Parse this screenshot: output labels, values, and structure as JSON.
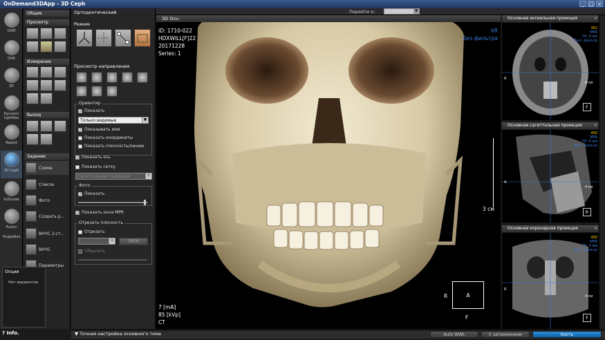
{
  "app": {
    "title": "OnDemand3DApp - 3D Ceph"
  },
  "nav": {
    "items": [
      {
        "label": "DXM"
      },
      {
        "label": "DVR"
      },
      {
        "label": "3D"
      },
      {
        "label": "Dynamic LightBox"
      },
      {
        "label": "Report"
      },
      {
        "label": "3D Ceph"
      },
      {
        "label": "In2Guide"
      },
      {
        "label": "Fusion"
      }
    ],
    "more_label": "Подробно",
    "info_label": "Info."
  },
  "panel2": {
    "header": "Общие",
    "view_section": "Просмотр",
    "measure_section": "Измерение",
    "output_section": "Выход",
    "task_section": "Задание",
    "tasks": [
      {
        "label": "Схема"
      },
      {
        "label": "Список"
      },
      {
        "label": "Фото"
      },
      {
        "label": "Создать р..."
      },
      {
        "label": "ВНЧС 2-ст..."
      },
      {
        "label": "ВНЧС"
      },
      {
        "label": "Параметры"
      }
    ],
    "options_title": "Опции",
    "options_empty": "Нет вариантов"
  },
  "panel3": {
    "title": "Ортодонтический",
    "mode_label": "Режим",
    "direction_label": "Просмотр направления",
    "orient_group": "Ориентир",
    "show_label": "Показать",
    "visibility_select": "Только видимые",
    "show_name": "Показывать имя",
    "show_coords": "Показать координаты",
    "show_planes": "Показать плоскость/линию",
    "show_axis": "Показать ось",
    "show_grid": "Показать сетку",
    "grid_select": "Сагиттальная проекция",
    "photo_group": "Фото",
    "photo_show": "Показать",
    "show_mpr": "Показать окна MPR",
    "cut_group": "Отрезать плоскость",
    "cut_label": "Отрезать",
    "start_btn": "ПУСК",
    "flip_label": "Обвалить"
  },
  "topbar": {
    "goto_label": "Перейти к:"
  },
  "viewer": {
    "title": "3D Осн.",
    "patient_id": "ID: 1710-022",
    "patient_name": "HDXWILL[F]22",
    "date": "20171228",
    "series": "Series: 1",
    "mode": "VR",
    "filter": "Без фильтра",
    "ma": "7 [mA]",
    "kvp": "85 [kVp]",
    "modality": "CT",
    "scale": "3 см",
    "orient_right": "R",
    "orient_anterior": "A",
    "orient_foot": "F"
  },
  "right_views": [
    {
      "title": "Основная аксиальная проекция",
      "num": "362",
      "mpr": "MPR",
      "th": "TH: 0 мм",
      "filter": "Вып. фильтр",
      "scale": "4 см",
      "box": "F",
      "side": "R"
    },
    {
      "title": "Основная сагиттальная проекция",
      "num": "400",
      "mpr": "MPR",
      "th": "TH: 0 мм",
      "filter": "Вып. фильтр",
      "scale": "4 см",
      "box": "R",
      "side": "A"
    },
    {
      "title": "Основная коронарная проекция",
      "num": "400",
      "mpr": "MPR",
      "th": "TH: 0 мм",
      "filter": "Вып. фильтр",
      "scale": "4 см",
      "box": "F",
      "side": "R"
    }
  ],
  "bottom": {
    "title": "Точная настройка основного тома",
    "auto_wwl": "Auto WWL",
    "shading": "С затемнением",
    "bone": "Кость"
  },
  "colors": {
    "accent": "#3a7bd5",
    "yellow": "#ffd000",
    "bone": "#e8dcc0"
  }
}
